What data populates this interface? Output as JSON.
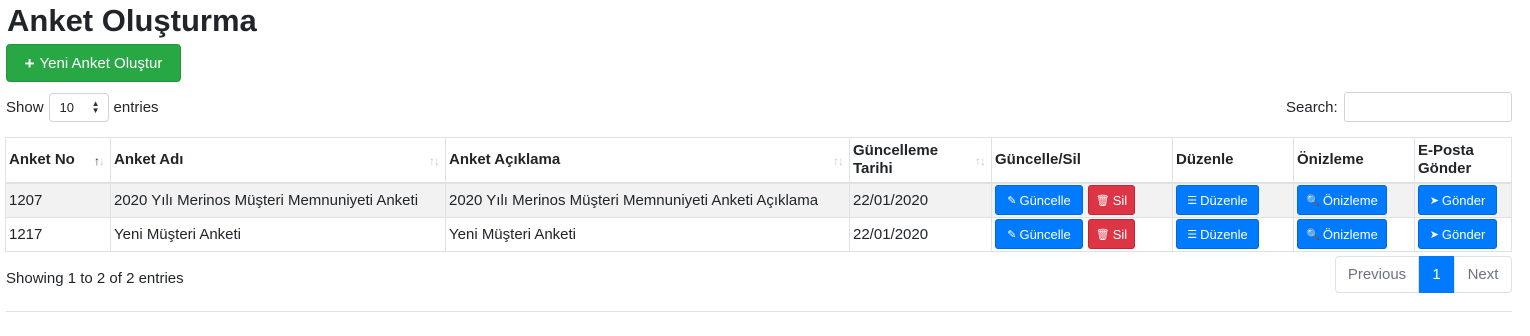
{
  "page": {
    "title": "Anket Oluşturma"
  },
  "toolbar": {
    "new_button_icon": "+",
    "new_button_label": "Yeni Anket Oluştur"
  },
  "length_menu": {
    "show_label": "Show",
    "value": "10",
    "entries_label": "entries"
  },
  "search": {
    "label": "Search:",
    "value": ""
  },
  "table": {
    "columns": [
      "Anket No",
      "Anket Adı",
      "Anket Açıklama",
      "Güncelleme Tarihi",
      "Güncelle/Sil",
      "Düzenle",
      "Önizleme",
      "E-Posta Gönder"
    ],
    "sort": {
      "column": "Anket No",
      "direction": "asc"
    },
    "rows": [
      {
        "no": "1207",
        "name": "2020 Yılı Merinos Müşteri Memnuniyeti Anketi",
        "description": "2020 Yılı Merinos Müşteri Memnuniyeti Anketi Açıklama",
        "date": "22/01/2020"
      },
      {
        "no": "1217",
        "name": "Yeni Müşteri Anketi",
        "description": "Yeni Müşteri Anketi",
        "date": "22/01/2020"
      }
    ],
    "actions": {
      "update": "Güncelle",
      "delete": "Sil",
      "edit": "Düzenle",
      "preview": "Önizleme",
      "send": "Gönder"
    },
    "icons": {
      "update": "pencil-icon",
      "delete": "trash-icon",
      "edit": "list-icon",
      "preview": "search-icon",
      "send": "paper-plane-icon"
    }
  },
  "info": "Showing 1 to 2 of 2 entries",
  "pagination": {
    "previous": "Previous",
    "current": "1",
    "next": "Next"
  },
  "colors": {
    "primary": "#007bff",
    "success": "#28a745",
    "danger": "#dc3545",
    "striped_row": "#f2f2f2"
  }
}
